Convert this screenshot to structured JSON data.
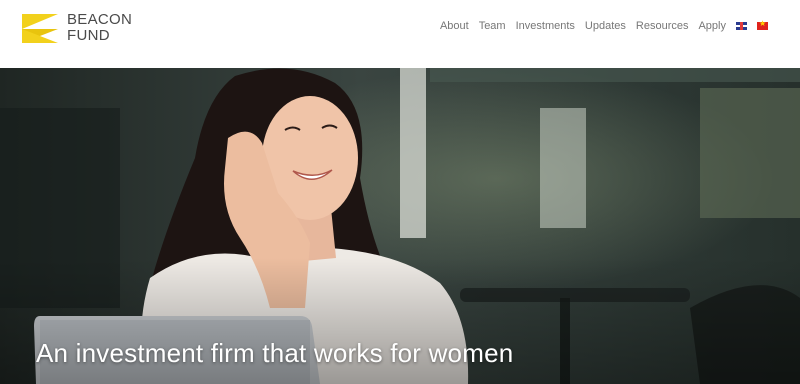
{
  "brand": {
    "line1": "BEACON",
    "line2": "FUND",
    "accent_color": "#f2d11c"
  },
  "nav": {
    "items": [
      {
        "label": "About"
      },
      {
        "label": "Team"
      },
      {
        "label": "Investments"
      },
      {
        "label": "Updates"
      },
      {
        "label": "Resources"
      },
      {
        "label": "Apply"
      }
    ],
    "languages": [
      {
        "icon": "uk-flag-icon"
      },
      {
        "icon": "vietnam-flag-icon"
      }
    ]
  },
  "hero": {
    "headline": "An investment firm that works for women",
    "image": "photo-woman-smiling-laptop-cafe"
  }
}
